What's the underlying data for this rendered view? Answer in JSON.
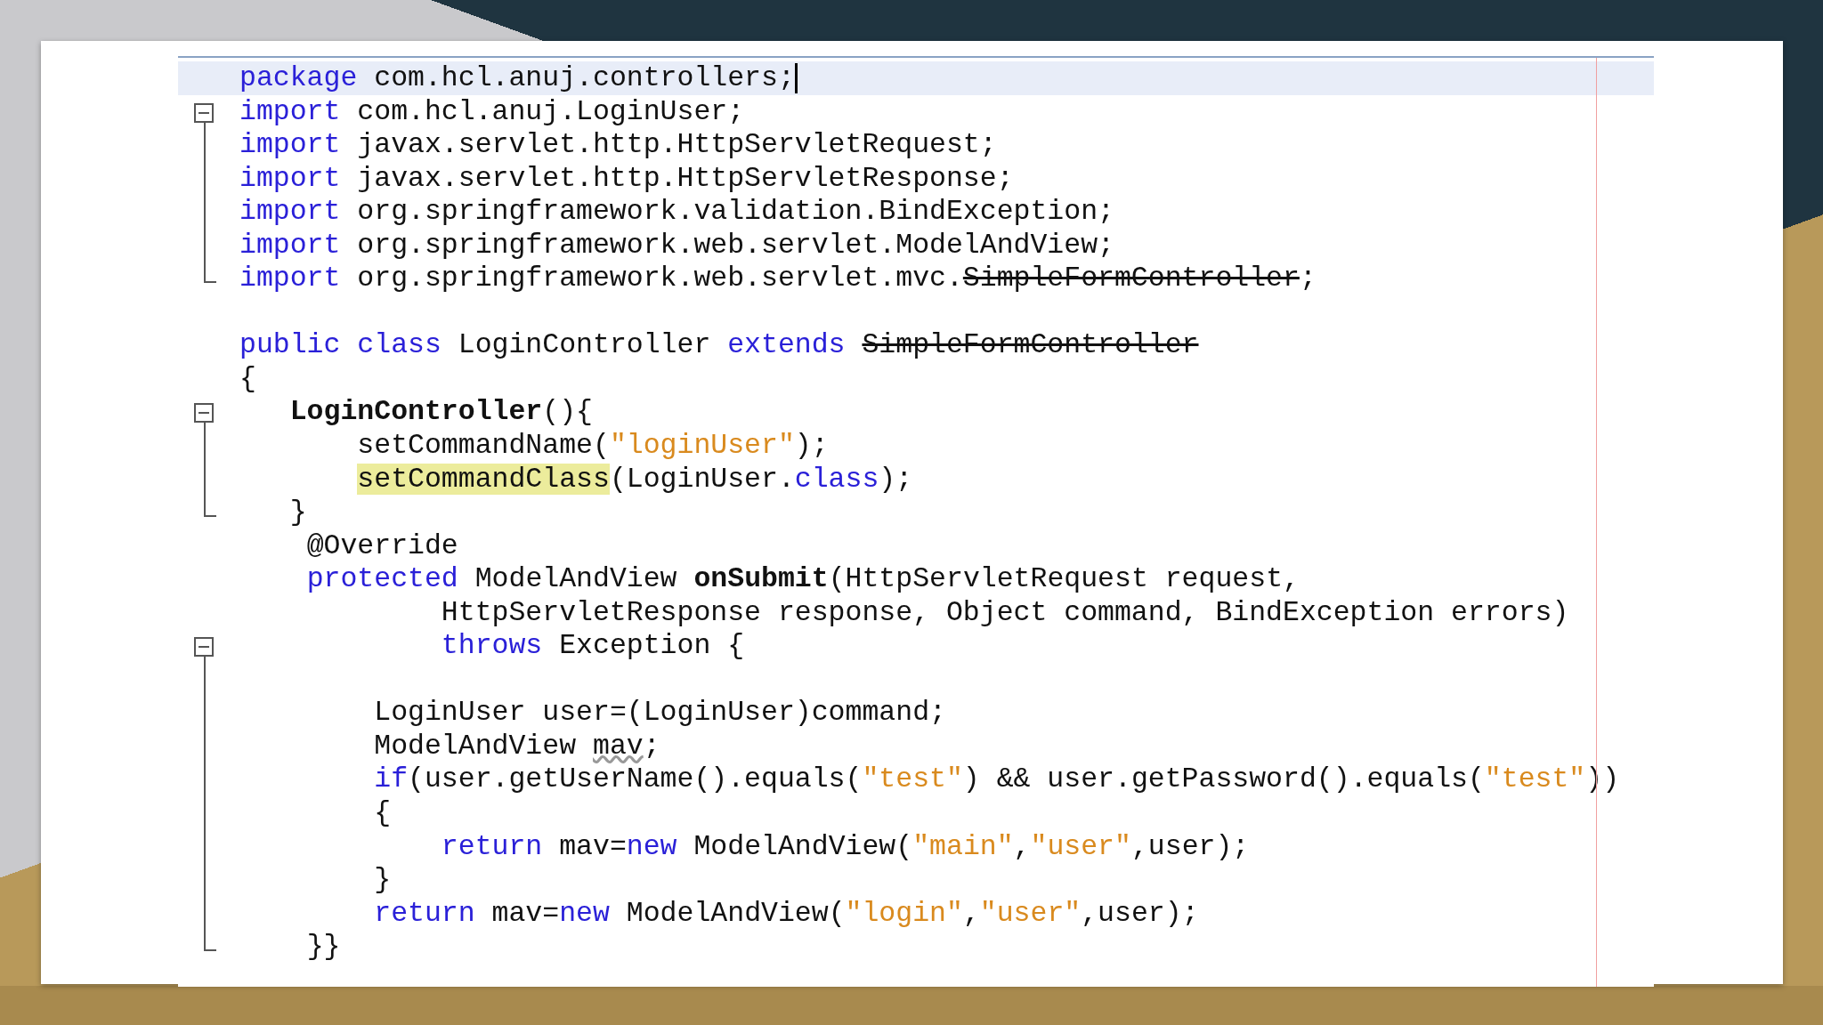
{
  "editor": {
    "lines": [
      {
        "current": true,
        "caret": true,
        "tokens": [
          {
            "t": "package",
            "kind": "keyword"
          },
          {
            "t": " com.hcl.anuj.controllers;",
            "kind": "plain"
          }
        ]
      },
      {
        "fold_open": true,
        "tokens": [
          {
            "t": "import",
            "kind": "keyword"
          },
          {
            "t": " com.hcl.anuj.LoginUser;",
            "kind": "plain"
          }
        ]
      },
      {
        "tokens": [
          {
            "t": "import",
            "kind": "keyword"
          },
          {
            "t": " javax.servlet.http.HttpServletRequest;",
            "kind": "plain"
          }
        ]
      },
      {
        "tokens": [
          {
            "t": "import",
            "kind": "keyword"
          },
          {
            "t": " javax.servlet.http.HttpServletResponse;",
            "kind": "plain"
          }
        ]
      },
      {
        "tokens": [
          {
            "t": "import",
            "kind": "keyword"
          },
          {
            "t": " org.springframework.validation.BindException;",
            "kind": "plain"
          }
        ]
      },
      {
        "tokens": [
          {
            "t": "import",
            "kind": "keyword"
          },
          {
            "t": " org.springframework.web.servlet.ModelAndView;",
            "kind": "plain"
          }
        ]
      },
      {
        "fold_end": true,
        "tokens": [
          {
            "t": "import",
            "kind": "keyword"
          },
          {
            "t": " org.springframework.web.servlet.mvc.",
            "kind": "plain"
          },
          {
            "t": "SimpleFormController",
            "kind": "deprecated"
          },
          {
            "t": ";",
            "kind": "plain"
          }
        ]
      },
      {
        "blank": true
      },
      {
        "tokens": [
          {
            "t": "public class",
            "kind": "keyword"
          },
          {
            "t": " LoginController ",
            "kind": "plain"
          },
          {
            "t": "extends ",
            "kind": "keyword"
          },
          {
            "t": "SimpleFormController",
            "kind": "deprecated"
          }
        ]
      },
      {
        "tokens": [
          {
            "t": "{",
            "kind": "plain"
          }
        ]
      },
      {
        "fold_open": true,
        "tokens": [
          {
            "t": "   LoginController",
            "kind": "declaration"
          },
          {
            "t": "(){",
            "kind": "plain"
          }
        ]
      },
      {
        "tokens": [
          {
            "t": "       setCommandName(",
            "kind": "plain"
          },
          {
            "t": "\"loginUser\"",
            "kind": "string"
          },
          {
            "t": ");",
            "kind": "plain"
          }
        ]
      },
      {
        "tokens": [
          {
            "t": "       setCommandClass",
            "kind": "highlight"
          },
          {
            "t": "(LoginUser.",
            "kind": "plain"
          },
          {
            "t": "class",
            "kind": "keyword"
          },
          {
            "t": ");",
            "kind": "plain"
          }
        ]
      },
      {
        "fold_end": true,
        "tokens": [
          {
            "t": "   }",
            "kind": "plain"
          }
        ]
      },
      {
        "tokens": [
          {
            "t": "    @Override",
            "kind": "plain"
          }
        ]
      },
      {
        "tokens": [
          {
            "t": "    protected",
            "kind": "keyword"
          },
          {
            "t": " ModelAndView ",
            "kind": "plain"
          },
          {
            "t": "onSubmit",
            "kind": "declaration"
          },
          {
            "t": "(HttpServletRequest request,",
            "kind": "plain"
          }
        ]
      },
      {
        "tokens": [
          {
            "t": "            HttpServletResponse response, Object command, BindException errors)",
            "kind": "plain"
          }
        ]
      },
      {
        "fold_open": true,
        "tokens": [
          {
            "t": "            throws",
            "kind": "keyword"
          },
          {
            "t": " Exception {",
            "kind": "plain"
          }
        ]
      },
      {
        "blank": true
      },
      {
        "tokens": [
          {
            "t": "        LoginUser user=(LoginUser)command;",
            "kind": "plain"
          }
        ]
      },
      {
        "tokens": [
          {
            "t": "        ModelAndView ",
            "kind": "plain"
          },
          {
            "t": "mav",
            "kind": "warning"
          },
          {
            "t": ";",
            "kind": "plain"
          }
        ]
      },
      {
        "tokens": [
          {
            "t": "        if",
            "kind": "keyword"
          },
          {
            "t": "(user.getUserName().equals(",
            "kind": "plain"
          },
          {
            "t": "\"test\"",
            "kind": "string"
          },
          {
            "t": ") && user.getPassword().equals(",
            "kind": "plain"
          },
          {
            "t": "\"test\"",
            "kind": "string"
          },
          {
            "t": "))",
            "kind": "plain"
          }
        ]
      },
      {
        "tokens": [
          {
            "t": "        {",
            "kind": "plain"
          }
        ]
      },
      {
        "tokens": [
          {
            "t": "            return",
            "kind": "keyword"
          },
          {
            "t": " mav=",
            "kind": "plain"
          },
          {
            "t": "new",
            "kind": "keyword"
          },
          {
            "t": " ModelAndView(",
            "kind": "plain"
          },
          {
            "t": "\"main\"",
            "kind": "string"
          },
          {
            "t": ",",
            "kind": "plain"
          },
          {
            "t": "\"user\"",
            "kind": "string"
          },
          {
            "t": ",user);",
            "kind": "plain"
          }
        ]
      },
      {
        "tokens": [
          {
            "t": "        }",
            "kind": "plain"
          }
        ]
      },
      {
        "tokens": [
          {
            "t": "        return",
            "kind": "keyword"
          },
          {
            "t": " mav=",
            "kind": "plain"
          },
          {
            "t": "new",
            "kind": "keyword"
          },
          {
            "t": " ModelAndView(",
            "kind": "plain"
          },
          {
            "t": "\"login\"",
            "kind": "string"
          },
          {
            "t": ",",
            "kind": "plain"
          },
          {
            "t": "\"user\"",
            "kind": "string"
          },
          {
            "t": ",user);",
            "kind": "plain"
          }
        ]
      },
      {
        "fold_end": true,
        "tokens": [
          {
            "t": "    }}",
            "kind": "plain"
          }
        ]
      }
    ]
  }
}
